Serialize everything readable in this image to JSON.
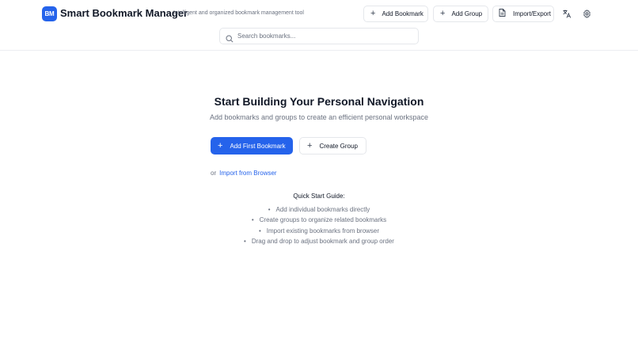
{
  "header": {
    "logo_text": "BM",
    "title": "Smart Bookmark Manager",
    "subtitle": "Intelligent and organized bookmark management tool",
    "buttons": {
      "add_bookmark": "Add Bookmark",
      "add_group": "Add Group",
      "import_export": "Import/Export"
    },
    "icons": [
      "plus-icon",
      "document-icon",
      "translate-icon",
      "gear-icon"
    ]
  },
  "search": {
    "placeholder": "Search bookmarks...",
    "value": ""
  },
  "empty_state": {
    "title": "Start Building Your Personal Navigation",
    "subtitle": "Add bookmarks and groups to create an efficient personal workspace",
    "primary_button": "Add First Bookmark",
    "secondary_button": "Create Group",
    "or_text": "or",
    "import_link": "Import from Browser"
  },
  "guide": {
    "title": "Quick Start Guide:",
    "items": [
      "Add individual bookmarks directly",
      "Create groups to organize related bookmarks",
      "Import existing bookmarks from browser",
      "Drag and drop to adjust bookmark and group order"
    ]
  },
  "colors": {
    "accent": "#2563eb",
    "text_primary": "#111827",
    "text_muted": "#6b7280",
    "border": "#e5e7eb"
  }
}
